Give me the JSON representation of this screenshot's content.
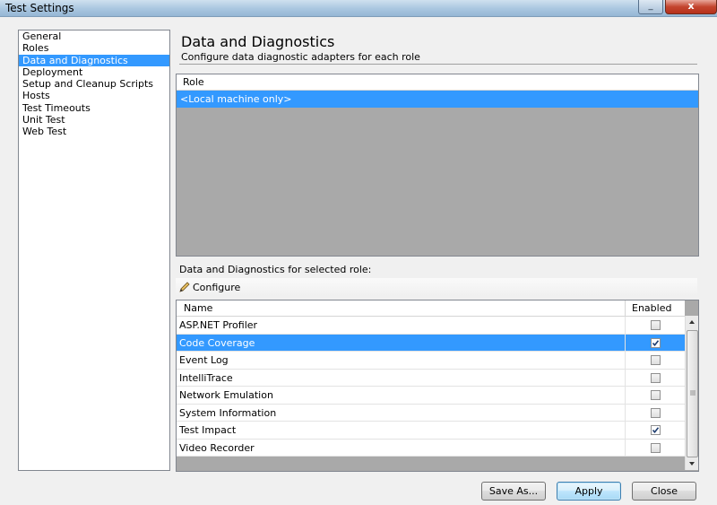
{
  "window": {
    "title": "Test Settings",
    "close_glyph": "x",
    "minimize_glyph": "_"
  },
  "nav": {
    "items": [
      {
        "label": "General",
        "selected": false
      },
      {
        "label": "Roles",
        "selected": false
      },
      {
        "label": "Data and Diagnostics",
        "selected": true
      },
      {
        "label": "Deployment",
        "selected": false
      },
      {
        "label": "Setup and Cleanup Scripts",
        "selected": false
      },
      {
        "label": "Hosts",
        "selected": false
      },
      {
        "label": "Test Timeouts",
        "selected": false
      },
      {
        "label": "Unit Test",
        "selected": false
      },
      {
        "label": "Web Test",
        "selected": false
      }
    ]
  },
  "page": {
    "title": "Data and Diagnostics",
    "subtitle": "Configure data diagnostic adapters for each role"
  },
  "roles": {
    "column_header": "Role",
    "rows": [
      {
        "label": "<Local machine only>",
        "selected": true
      }
    ]
  },
  "diagnostics": {
    "section_label": "Data and Diagnostics for selected role:",
    "configure_label": "Configure",
    "columns": {
      "name": "Name",
      "enabled": "Enabled"
    },
    "rows": [
      {
        "name": "ASP.NET Profiler",
        "enabled": false,
        "selected": false
      },
      {
        "name": "Code Coverage",
        "enabled": true,
        "selected": true
      },
      {
        "name": "Event Log",
        "enabled": false,
        "selected": false
      },
      {
        "name": "IntelliTrace",
        "enabled": false,
        "selected": false
      },
      {
        "name": "Network Emulation",
        "enabled": false,
        "selected": false
      },
      {
        "name": "System Information",
        "enabled": false,
        "selected": false
      },
      {
        "name": "Test Impact",
        "enabled": true,
        "selected": false
      },
      {
        "name": "Video Recorder",
        "enabled": false,
        "selected": false
      }
    ]
  },
  "buttons": {
    "save_as": "Save As...",
    "apply": "Apply",
    "close": "Close"
  },
  "icons": {
    "configure": "pencil-icon",
    "check": "check-icon",
    "scroll_up": "arrow-up-icon",
    "scroll_down": "arrow-down-icon"
  },
  "colors": {
    "selection": "#3399ff",
    "empty_area": "#a9a9a9",
    "titlebar": "#a9c6e0"
  }
}
